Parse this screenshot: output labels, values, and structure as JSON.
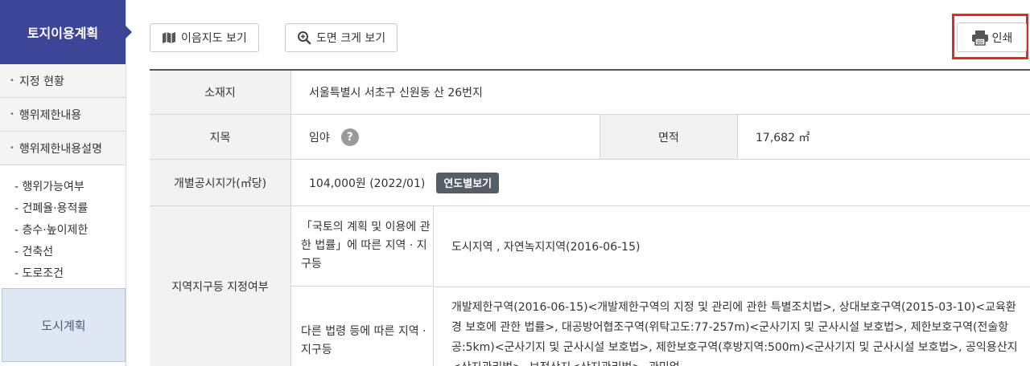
{
  "sidebar": {
    "title": "토지이용계획",
    "items": [
      {
        "label": "지정 현황"
      },
      {
        "label": "행위제한내용"
      },
      {
        "label": "행위제한내용설명"
      }
    ],
    "sub_items": [
      {
        "label": "- 행위가능여부"
      },
      {
        "label": "- 건폐율·용적률"
      },
      {
        "label": "- 층수·높이제한"
      },
      {
        "label": "- 건축선"
      },
      {
        "label": "- 도로조건"
      }
    ],
    "city_plan": "도시계획"
  },
  "toolbar": {
    "map_label": "이음지도 보기",
    "zoom_label": "도면 크게 보기",
    "print_label": "인쇄"
  },
  "table": {
    "location_label": "소재지",
    "location_value": "서울특별시 서초구 신원동 산 26번지",
    "category_label": "지목",
    "category_value": "임야",
    "help_glyph": "?",
    "area_label": "면적",
    "area_value": "17,682 ㎡",
    "price_label": "개별공시지가(㎡당)",
    "price_value": "104,000원 (2022/01)",
    "yearly_button": "연도별보기",
    "zone_label": "지역지구등 지정여부",
    "zone_law1_label": "「국토의 계획 및 이용에 관한 법률」에 따른 지역 · 지구등",
    "zone_law1_value": "도시지역 , 자연녹지지역(2016-06-15)",
    "zone_law2_label": "다른 법령 등에 따른 지역 · 지구등",
    "zone_law2_value": "개발제한구역(2016-06-15)<개발제한구역의 지정 및 관리에 관한 특별조치법>, 상대보호구역(2015-03-10)<교육환경 보호에 관한 법률>, 대공방어협조구역(위탁고도:77-257m)<군사기지 및 군사시설 보호법>, 제한보호구역(전술항공:5km)<군사기지 및 군사시설 보호법>, 제한보호구역(후방지역:500m)<군사기지 및 군사시설 보호법>, 공익용산지<산지관리법>, 보전산지<산지관리법>, 관믹업"
  },
  "colors": {
    "sidebar_title_bg": "#3d4596",
    "highlight_border": "#e6262b",
    "year_button_bg": "#555d66"
  }
}
